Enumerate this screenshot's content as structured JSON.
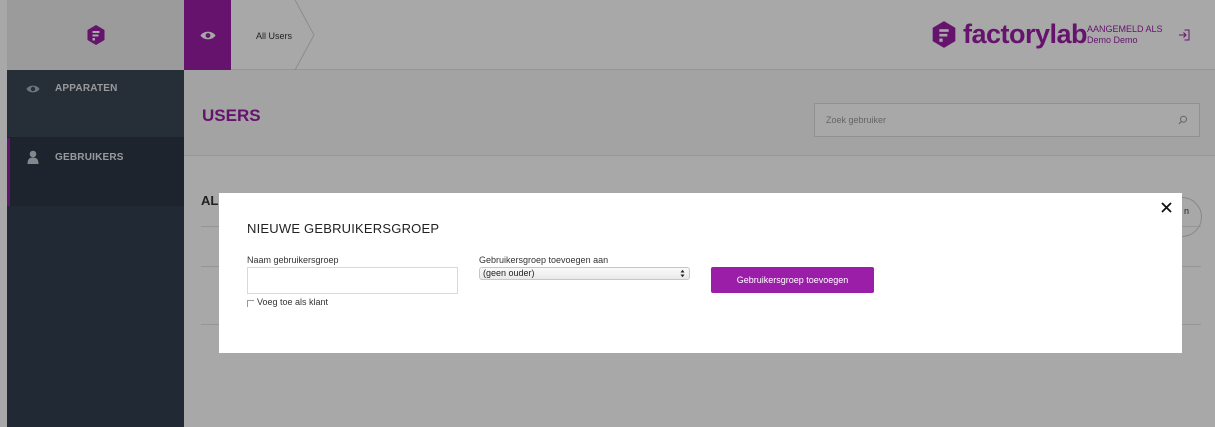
{
  "sidebar": {
    "items": [
      {
        "label": "APPARATEN",
        "icon": "eye-icon"
      },
      {
        "label": "GEBRUIKERS",
        "icon": "user-icon"
      }
    ]
  },
  "header": {
    "breadcrumb": "All Users",
    "brand_name": "factorylab",
    "signed_in_label": "AANGEMELD ALS",
    "user_name": "Demo Demo"
  },
  "main": {
    "title": "USERS",
    "search_placeholder": "Zoek gebruiker",
    "section_title_fragment": "AL",
    "circle_button_fragment": "n"
  },
  "modal": {
    "title": "NIEUWE GEBRUIKERSGROEP",
    "name_label": "Naam gebruikersgroep",
    "name_value": "",
    "parent_label": "Gebruikersgroep toevoegen aan",
    "parent_selected": "(geen ouder)",
    "customer_checkbox_label": "Voeg toe als klant",
    "customer_checked": false,
    "submit_label": "Gebruikersgroep toevoegen"
  },
  "colors": {
    "accent": "#9b1ea8",
    "sidebar": "#33404f"
  }
}
